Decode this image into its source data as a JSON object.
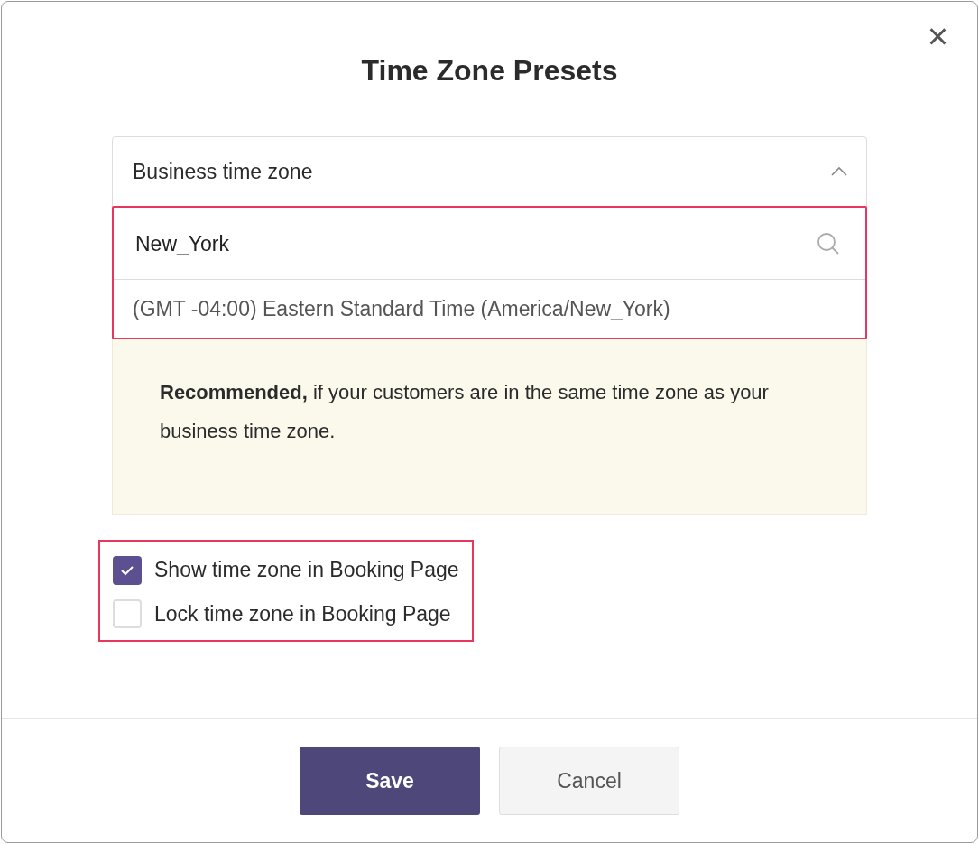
{
  "dialog": {
    "title": "Time Zone Presets",
    "close_label": "×"
  },
  "select": {
    "value": "Business time zone",
    "expanded": true
  },
  "dropdown": {
    "highlighted": true,
    "search_value": "New_York",
    "options": [
      {
        "label": "(GMT -04:00) Eastern Standard Time (America/New_York)",
        "selected": false
      }
    ]
  },
  "note": {
    "paragraphs": [
      "**Recommended,** if your customers are in the same time zone as your business time zone."
    ]
  },
  "options_group": {
    "highlighted": true,
    "checkboxes": [
      {
        "label": "Show time zone in Booking Page",
        "checked": true
      },
      {
        "label": "Lock time zone in Booking Page",
        "checked": false
      }
    ]
  },
  "buttons": [
    {
      "label": "Save",
      "kind": "primary"
    },
    {
      "label": "Cancel",
      "kind": "secondary"
    }
  ]
}
